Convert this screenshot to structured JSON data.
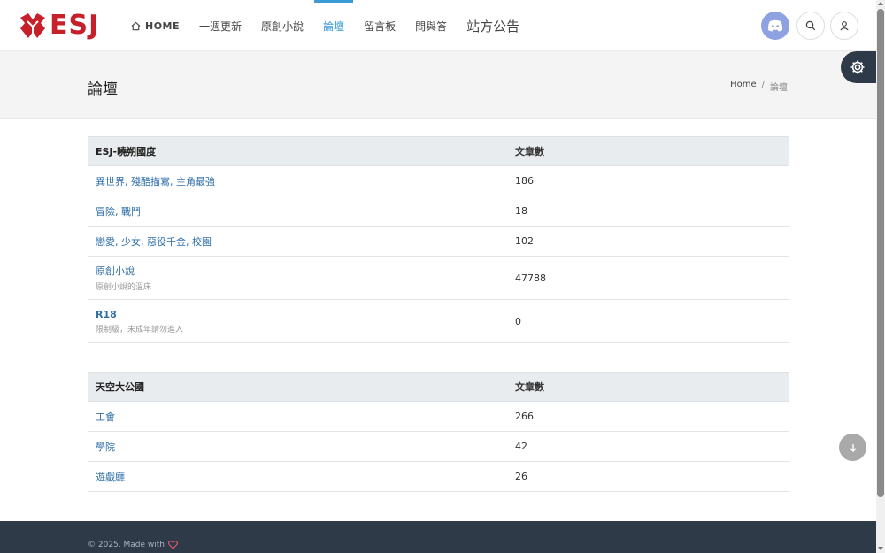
{
  "header": {
    "logo_text": "ESJ",
    "nav": [
      {
        "label": "HOME",
        "active": false
      },
      {
        "label": "一週更新",
        "active": false
      },
      {
        "label": "原創小說",
        "active": false
      },
      {
        "label": "論壇",
        "active": true
      },
      {
        "label": "留言板",
        "active": false
      },
      {
        "label": "問與答",
        "active": false
      },
      {
        "label": "站方公告",
        "active": false
      }
    ],
    "icons": {
      "discord": "discord-icon",
      "search": "search-icon",
      "user": "user-icon",
      "settings": "gear-icon",
      "scroll": "arrow-down-icon"
    }
  },
  "pagehead": {
    "title": "論壇",
    "breadcrumb": {
      "home": "Home",
      "sep": "/",
      "current": "論壇"
    }
  },
  "sections": [
    {
      "title": "ESJ-曉朔國度",
      "count_header": "文章數",
      "rows": [
        {
          "name": "異世界, 殘酷描寫, 主角最強",
          "desc": "",
          "count": "186"
        },
        {
          "name": "冒險, 戰鬥",
          "desc": "",
          "count": "18"
        },
        {
          "name": "戀愛, 少女, 惡役千金, 校園",
          "desc": "",
          "count": "102"
        },
        {
          "name": "原創小說",
          "desc": "原創小說的溫床",
          "count": "47788"
        },
        {
          "name": "R18",
          "desc": "限制級，未成年請勿進入",
          "count": "0"
        }
      ]
    },
    {
      "title": "天空大公國",
      "count_header": "文章數",
      "rows": [
        {
          "name": "工會",
          "desc": "",
          "count": "266"
        },
        {
          "name": "學院",
          "desc": "",
          "count": "42"
        },
        {
          "name": "遊戲廳",
          "desc": "",
          "count": "26"
        }
      ]
    }
  ],
  "footer": {
    "text": "© 2025. Made with"
  },
  "colors": {
    "brand": "#c8202a",
    "accent": "#3a9bd5",
    "link": "#2f6fa7",
    "footer_bg": "#2f3a48",
    "discord": "#8ea1e1"
  }
}
